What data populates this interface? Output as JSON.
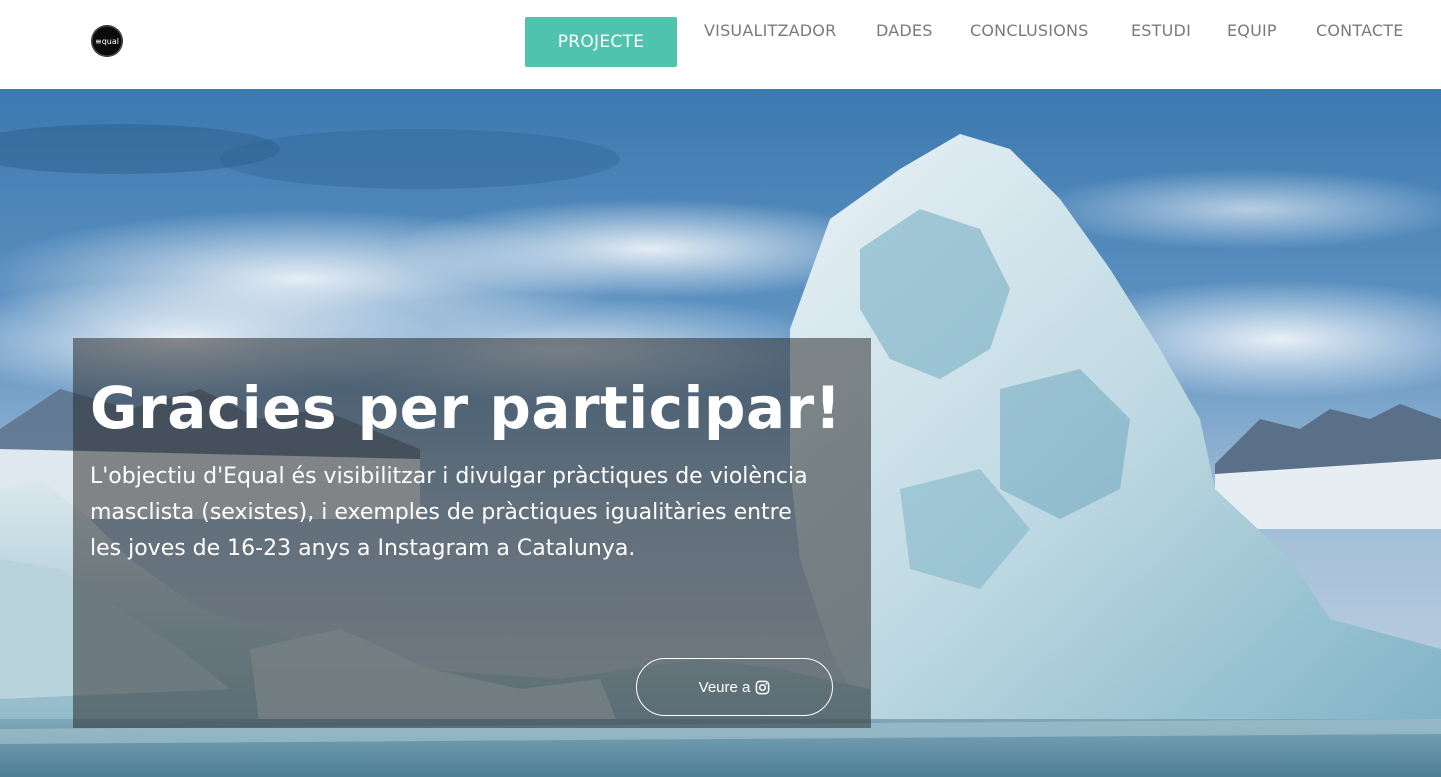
{
  "navbar": {
    "logo_icon": "equal-logo-icon",
    "items": [
      {
        "label": "PROJECTE",
        "active": true
      },
      {
        "label": "VISUALITZADOR"
      },
      {
        "label": "DADES"
      },
      {
        "label": "CONCLUSIONS"
      },
      {
        "label": "ESTUDI"
      },
      {
        "label": "EQUIP"
      },
      {
        "label": "CONTACTE"
      }
    ]
  },
  "hero": {
    "title": "Gracies per participar!",
    "description": "L'objectiu d'Equal és visibilitzar i divulgar pràctiques de violència masclista (sexistes), i exemples de pràctiques igualitàries entre les joves de 16-23 anys a Instagram a Catalunya.",
    "cta_label": "Veure a",
    "cta_icon": "instagram-icon",
    "background": "iceberg-photo"
  },
  "colors": {
    "accent": "#4fc3ad",
    "nav_text": "#7a7a7a",
    "overlay": "rgba(40,40,40,0.52)"
  }
}
